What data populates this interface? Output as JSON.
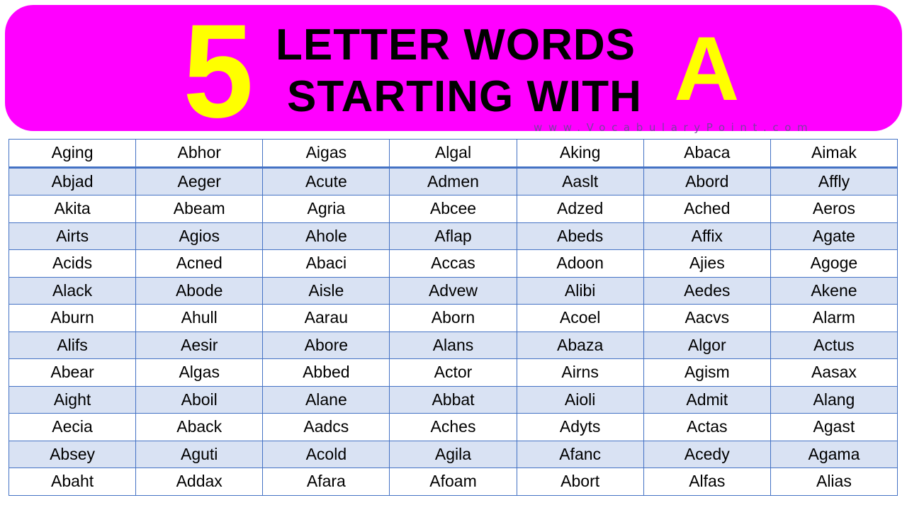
{
  "header": {
    "number": "5",
    "line1": "LETTER WORDS",
    "line2": "STARTING WITH",
    "letter": "A",
    "website": "www.VocabularyPoint.com",
    "colors": {
      "banner_background": "#ff00ff",
      "highlight": "#ffff00",
      "title_text": "#000000",
      "website_text": "#7b3fa0"
    }
  },
  "table": {
    "colors": {
      "border": "#4472c4",
      "alt_row": "#d9e2f3"
    },
    "rows": [
      [
        "Aging",
        "Abhor",
        "Aigas",
        "Algal",
        "Aking",
        "Abaca",
        "Aimak"
      ],
      [
        "Abjad",
        "Aeger",
        "Acute",
        "Admen",
        "Aaslt",
        "Abord",
        "Affly"
      ],
      [
        "Akita",
        "Abeam",
        "Agria",
        "Abcee",
        "Adzed",
        "Ached",
        "Aeros"
      ],
      [
        "Airts",
        "Agios",
        "Ahole",
        "Aflap",
        "Abeds",
        "Affix",
        "Agate"
      ],
      [
        "Acids",
        "Acned",
        "Abaci",
        "Accas",
        "Adoon",
        "Ajies",
        "Agoge"
      ],
      [
        "Alack",
        "Abode",
        "Aisle",
        "Advew",
        "Alibi",
        "Aedes",
        "Akene"
      ],
      [
        "Aburn",
        "Ahull",
        "Aarau",
        "Aborn",
        "Acoel",
        "Aacvs",
        "Alarm"
      ],
      [
        "Alifs",
        "Aesir",
        "Abore",
        "Alans",
        "Abaza",
        "Algor",
        "Actus"
      ],
      [
        "Abear",
        "Algas",
        "Abbed",
        "Actor",
        "Airns",
        "Agism",
        "Aasax"
      ],
      [
        "Aight",
        "Aboil",
        "Alane",
        "Abbat",
        "Aioli",
        "Admit",
        "Alang"
      ],
      [
        "Aecia",
        "Aback",
        "Aadcs",
        "Aches",
        "Adyts",
        "Actas",
        "Agast"
      ],
      [
        "Absey",
        "Aguti",
        "Acold",
        "Agila",
        "Afanc",
        "Acedy",
        "Agama"
      ],
      [
        "Abaht",
        "Addax",
        "Afara",
        "Afoam",
        "Abort",
        "Alfas",
        "Alias"
      ]
    ]
  }
}
